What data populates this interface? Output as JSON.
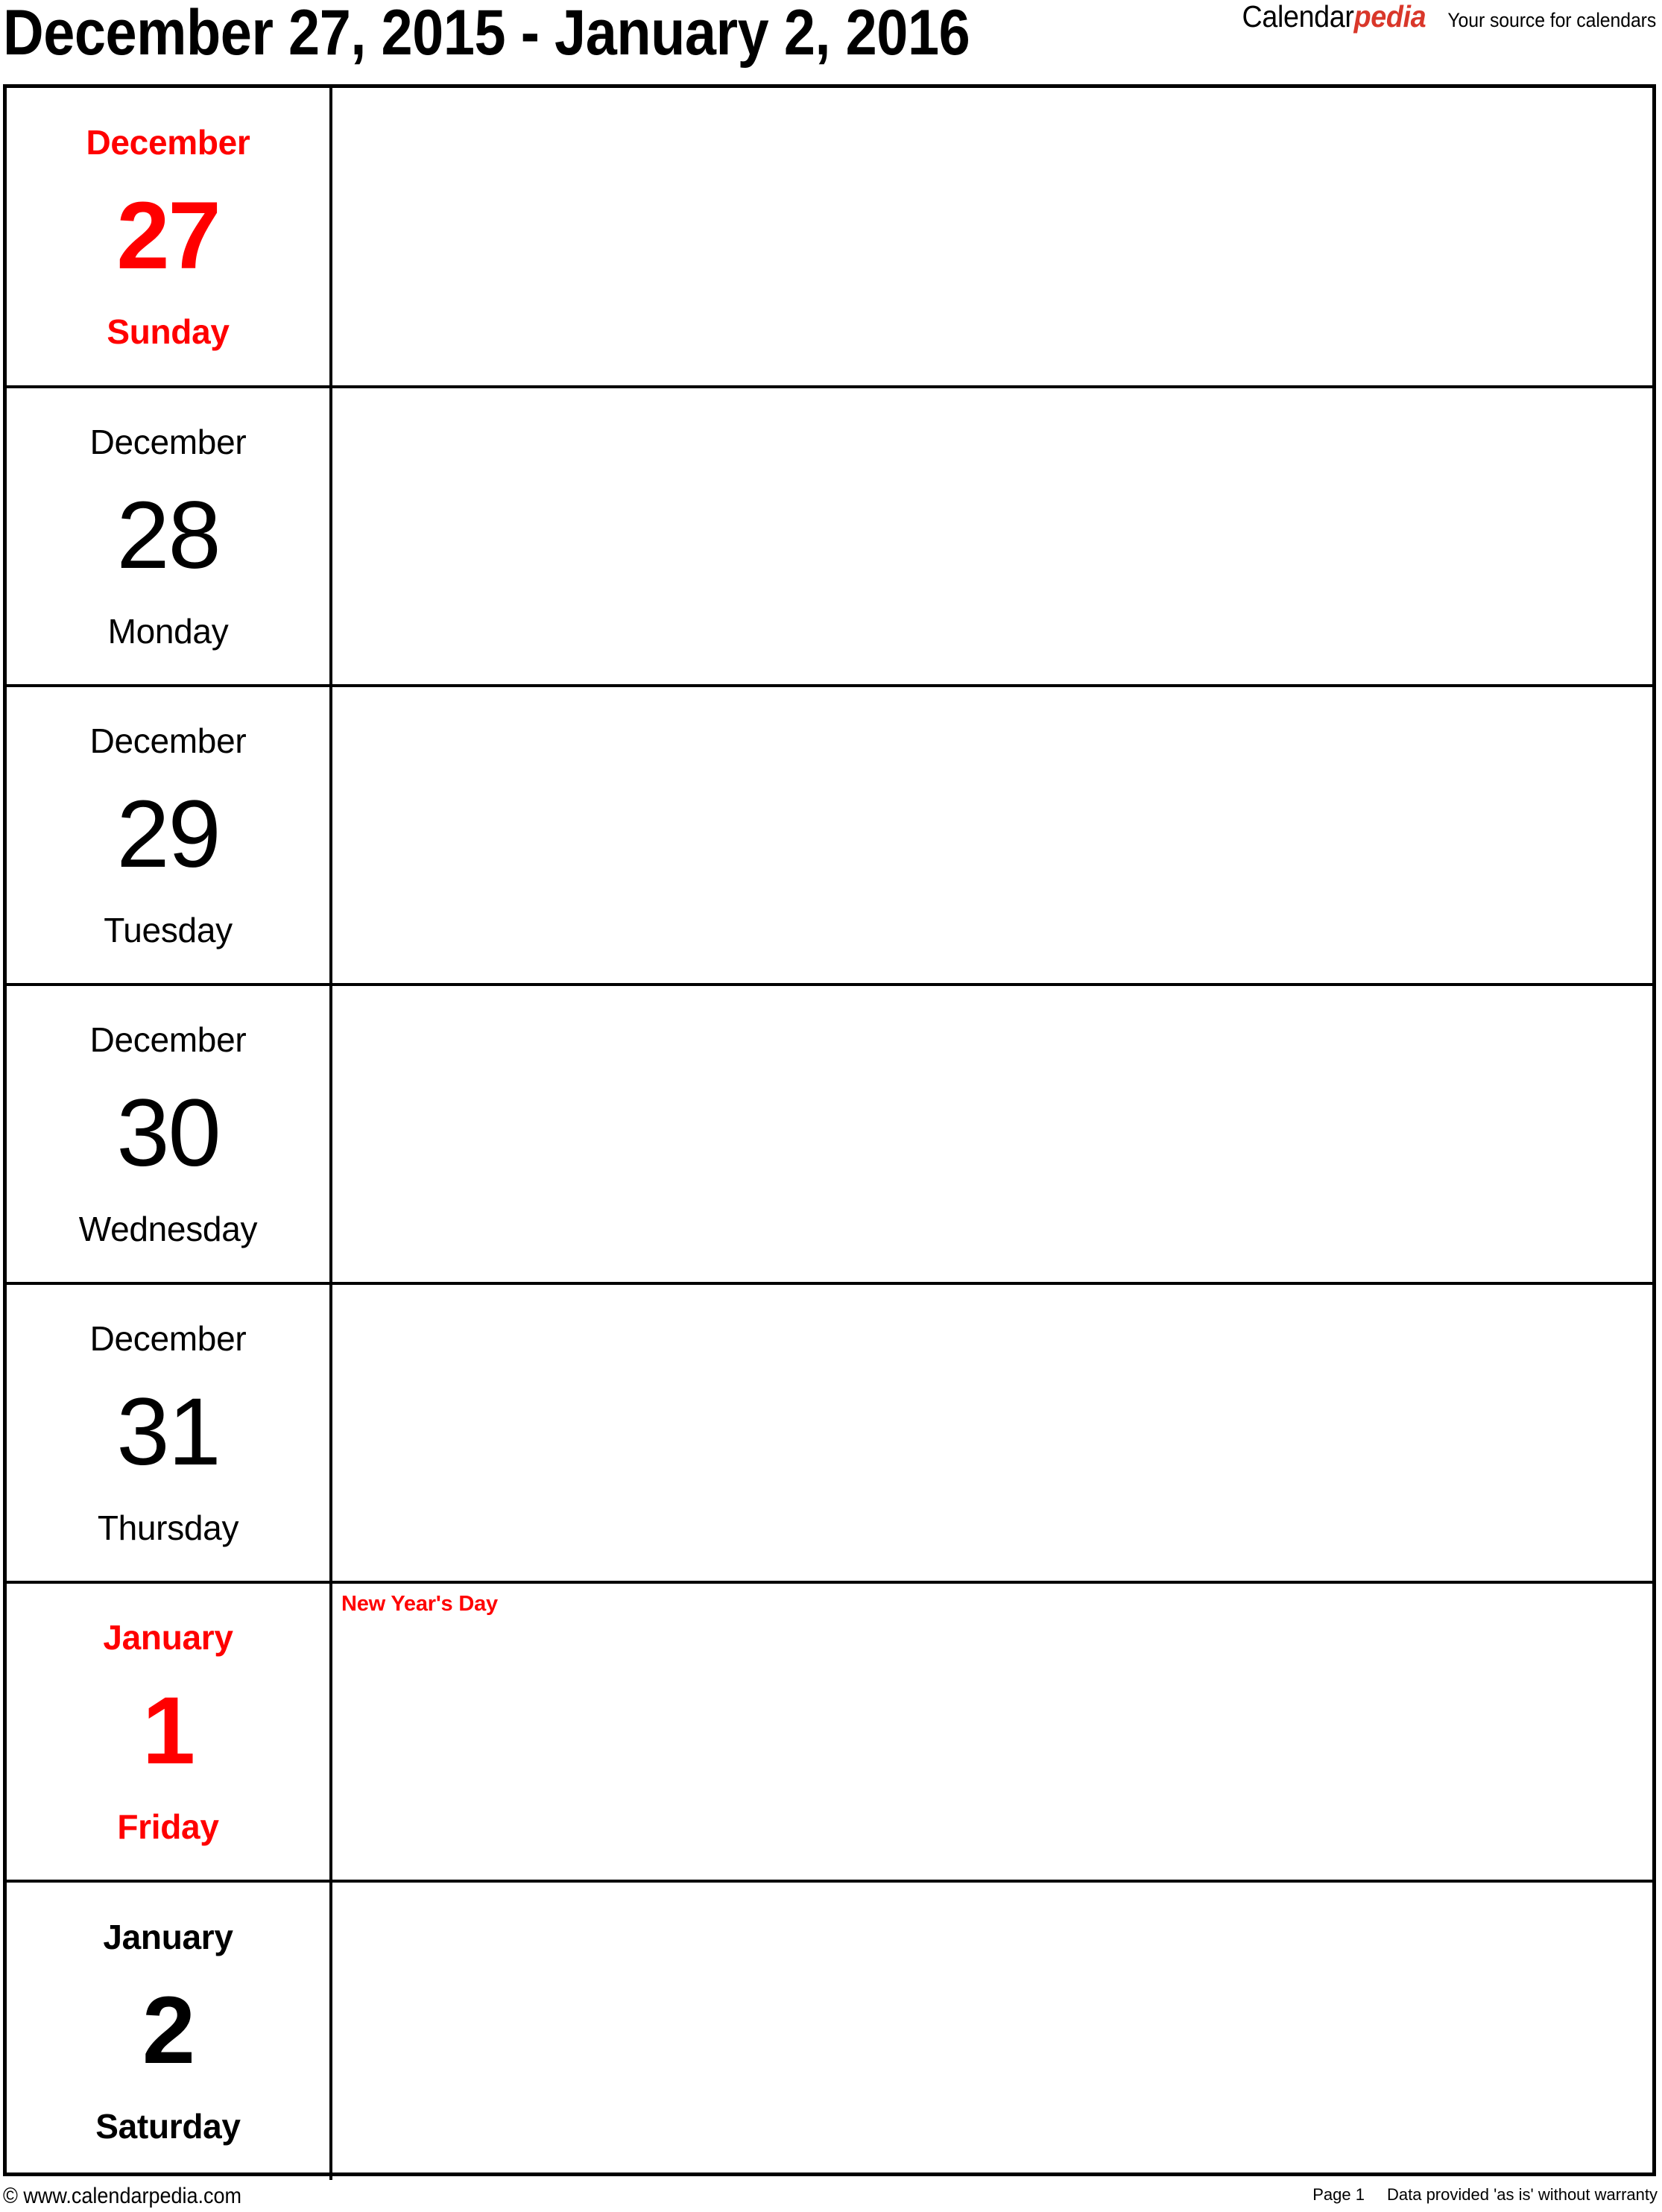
{
  "header": {
    "title": "December 27, 2015 - January 2, 2016",
    "brand": {
      "name_black": "Calendar",
      "name_red": "pedia",
      "tagline": "Your source for calendars"
    }
  },
  "calendar": {
    "days": [
      {
        "month": "December",
        "number": "27",
        "weekday": "Sunday",
        "style": "sunday",
        "event": ""
      },
      {
        "month": "December",
        "number": "28",
        "weekday": "Monday",
        "style": "weekday",
        "event": ""
      },
      {
        "month": "December",
        "number": "29",
        "weekday": "Tuesday",
        "style": "weekday",
        "event": ""
      },
      {
        "month": "December",
        "number": "30",
        "weekday": "Wednesday",
        "style": "weekday",
        "event": ""
      },
      {
        "month": "December",
        "number": "31",
        "weekday": "Thursday",
        "style": "weekday",
        "event": ""
      },
      {
        "month": "January",
        "number": "1",
        "weekday": "Friday",
        "style": "holiday",
        "event": "New Year's Day"
      },
      {
        "month": "January",
        "number": "2",
        "weekday": "Saturday",
        "style": "saturday",
        "event": ""
      }
    ]
  },
  "footer": {
    "copyright": "© www.calendarpedia.com",
    "page": "Page 1",
    "disclaimer": "Data provided 'as is' without warranty"
  },
  "colors": {
    "holiday_red": "#ff0000",
    "brand_red": "#d9372a",
    "text_black": "#000000",
    "background": "#ffffff"
  }
}
